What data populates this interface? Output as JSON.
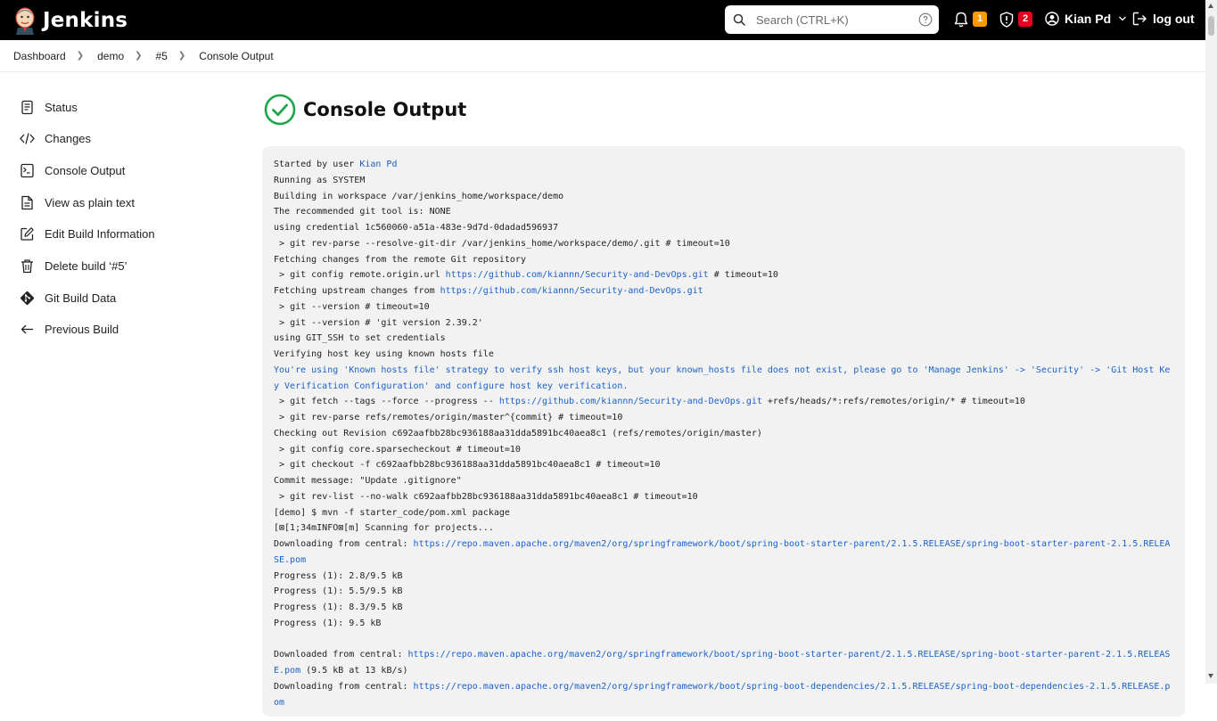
{
  "header": {
    "brand": "Jenkins",
    "search_placeholder": "Search (CTRL+K)",
    "notifications_count": "1",
    "security_count": "2",
    "user_name": "Kian Pd",
    "logout_label": "log out",
    "colors": {
      "bar": "#000000",
      "notification_badge": "#fe9a00",
      "security_badge": "#e6001f"
    }
  },
  "breadcrumb": [
    "Dashboard",
    "demo",
    "#5",
    "Console Output"
  ],
  "sidebar": {
    "items": [
      {
        "label": "Status",
        "icon": "document-icon"
      },
      {
        "label": "Changes",
        "icon": "code-icon"
      },
      {
        "label": "Console Output",
        "icon": "terminal-icon"
      },
      {
        "label": "View as plain text",
        "icon": "file-text-icon"
      },
      {
        "label": "Edit Build Information",
        "icon": "edit-icon"
      },
      {
        "label": "Delete build ‘#5’",
        "icon": "trash-icon"
      },
      {
        "label": "Git Build Data",
        "icon": "git-icon"
      },
      {
        "label": "Previous Build",
        "icon": "arrow-left-icon"
      }
    ]
  },
  "main": {
    "title": "Console Output",
    "status_color": "#1ea64b",
    "console_lines": [
      [
        {
          "t": "Started by user "
        },
        {
          "t": "Kian Pd",
          "link": true
        }
      ],
      [
        {
          "t": "Running as SYSTEM"
        }
      ],
      [
        {
          "t": "Building in workspace /var/jenkins_home/workspace/demo"
        }
      ],
      [
        {
          "t": "The recommended git tool is: NONE"
        }
      ],
      [
        {
          "t": "using credential 1c560060-a51a-483e-9d7d-0dadad596937"
        }
      ],
      [
        {
          "t": " > git rev-parse --resolve-git-dir /var/jenkins_home/workspace/demo/.git # timeout=10"
        }
      ],
      [
        {
          "t": "Fetching changes from the remote Git repository"
        }
      ],
      [
        {
          "t": " > git config remote.origin.url "
        },
        {
          "t": "https://github.com/kiannn/Security-and-DevOps.git",
          "link": true
        },
        {
          "t": " # timeout=10"
        }
      ],
      [
        {
          "t": "Fetching upstream changes from "
        },
        {
          "t": "https://github.com/kiannn/Security-and-DevOps.git",
          "link": true
        }
      ],
      [
        {
          "t": " > git --version # timeout=10"
        }
      ],
      [
        {
          "t": " > git --version # 'git version 2.39.2'"
        }
      ],
      [
        {
          "t": "using GIT_SSH to set credentials"
        }
      ],
      [
        {
          "t": "Verifying host key using known hosts file"
        }
      ],
      [
        {
          "t": "You're using 'Known hosts file' strategy to verify ssh host keys, but your known_hosts file does not exist, please go to 'Manage Jenkins' -> 'Security' -> 'Git Host Key Verification Configuration' and configure host key verification.",
          "note": true
        }
      ],
      [
        {
          "t": " > git fetch --tags --force --progress -- "
        },
        {
          "t": "https://github.com/kiannn/Security-and-DevOps.git",
          "link": true
        },
        {
          "t": " +refs/heads/*:refs/remotes/origin/* # timeout=10"
        }
      ],
      [
        {
          "t": " > git rev-parse refs/remotes/origin/master^{commit} # timeout=10"
        }
      ],
      [
        {
          "t": "Checking out Revision c692aafbb28bc936188aa31dda5891bc40aea8c1 (refs/remotes/origin/master)"
        }
      ],
      [
        {
          "t": " > git config core.sparsecheckout # timeout=10"
        }
      ],
      [
        {
          "t": " > git checkout -f c692aafbb28bc936188aa31dda5891bc40aea8c1 # timeout=10"
        }
      ],
      [
        {
          "t": "Commit message: \"Update .gitignore\""
        }
      ],
      [
        {
          "t": " > git rev-list --no-walk c692aafbb28bc936188aa31dda5891bc40aea8c1 # timeout=10"
        }
      ],
      [
        {
          "t": "[demo] $ mvn -f starter_code/pom.xml package"
        }
      ],
      [
        {
          "t": "[⊠[1;34mINFO⊠[m] Scanning for projects..."
        }
      ],
      [
        {
          "t": "Downloading from central: "
        },
        {
          "t": "https://repo.maven.apache.org/maven2/org/springframework/boot/spring-boot-starter-parent/2.1.5.RELEASE/spring-boot-starter-parent-2.1.5.RELEASE.pom",
          "link": true
        }
      ],
      [
        {
          "t": "Progress (1): 2.8/9.5 kB"
        }
      ],
      [
        {
          "t": "Progress (1): 5.5/9.5 kB"
        }
      ],
      [
        {
          "t": "Progress (1): 8.3/9.5 kB"
        }
      ],
      [
        {
          "t": "Progress (1): 9.5 kB"
        }
      ],
      [
        {
          "t": ""
        }
      ],
      [
        {
          "t": "Downloaded from central: "
        },
        {
          "t": "https://repo.maven.apache.org/maven2/org/springframework/boot/spring-boot-starter-parent/2.1.5.RELEASE/spring-boot-starter-parent-2.1.5.RELEASE.pom",
          "link": true
        },
        {
          "t": " (9.5 kB at 13 kB/s)"
        }
      ],
      [
        {
          "t": "Downloading from central: "
        },
        {
          "t": "https://repo.maven.apache.org/maven2/org/springframework/boot/spring-boot-dependencies/2.1.5.RELEASE/spring-boot-dependencies-2.1.5.RELEASE.pom",
          "link": true
        }
      ]
    ]
  }
}
